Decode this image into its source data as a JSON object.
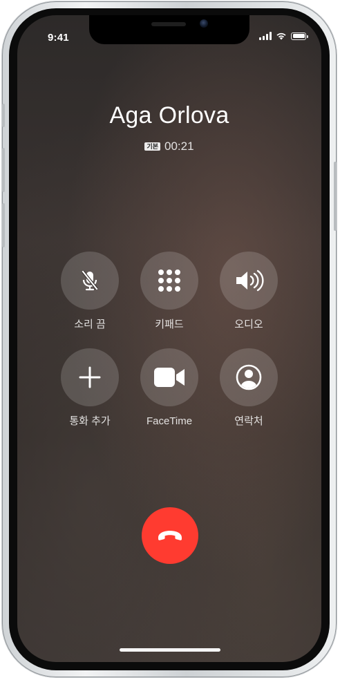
{
  "status_bar": {
    "time": "9:41"
  },
  "call": {
    "contact_name": "Aga Orlova",
    "call_type_badge": "기본",
    "duration": "00:21"
  },
  "controls": [
    {
      "label": "소리 끔",
      "icon": "muted-microphone-icon"
    },
    {
      "label": "키패드",
      "icon": "keypad-icon"
    },
    {
      "label": "오디오",
      "icon": "speaker-icon"
    },
    {
      "label": "통화 추가",
      "icon": "plus-icon"
    },
    {
      "label": "FaceTime",
      "icon": "video-camera-icon"
    },
    {
      "label": "연락처",
      "icon": "contact-icon"
    }
  ],
  "end_call": {
    "icon": "phone-hangup-icon",
    "color": "#ff3b30"
  }
}
